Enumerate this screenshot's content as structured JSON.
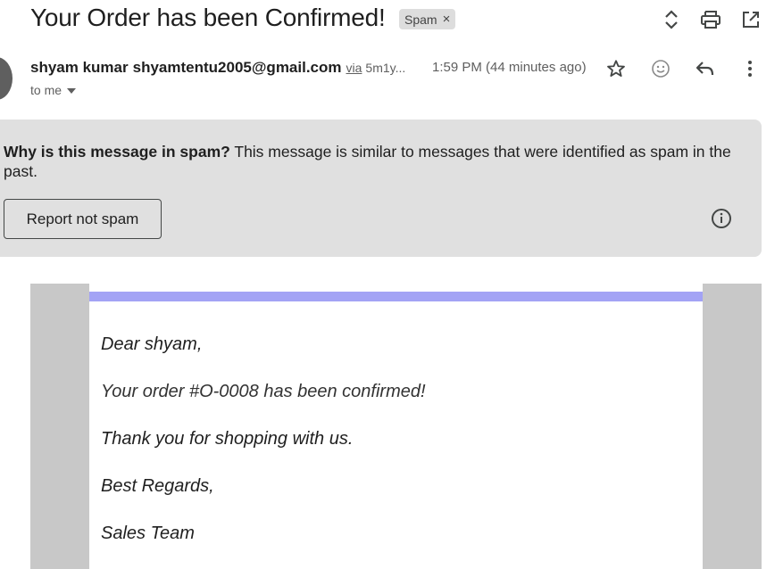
{
  "email": {
    "subject": "Your Order has been Confirmed!",
    "label_chip": "Spam",
    "label_remove": "×",
    "sender_name": "shyam kumar",
    "sender_email": "shyamtentu2005@gmail.com",
    "via_label": "via",
    "via_domain": "5m1y...",
    "time": "1:59 PM (44 minutes ago)",
    "recipient": "to me"
  },
  "spam_notice": {
    "heading": "Why is this message in spam?",
    "text": " This message is similar to messages that were identified as spam in the past.",
    "report_button": "Report not spam"
  },
  "body": {
    "greeting": "Dear shyam,",
    "order_line": "Your order #O-0008 has been confirmed!",
    "thanks_line": "Thank you for shopping with us.",
    "closing": "Best Regards,",
    "signature": "Sales Team"
  },
  "colors": {
    "accent_bar": "#a3a3f5",
    "banner_bg": "#e0e0e0",
    "frame_bg": "#c8c8c8"
  },
  "icons": {
    "expand": "unfold-icon",
    "print": "print-icon",
    "popout": "open-in-new-icon",
    "star": "star-icon",
    "emoji": "emoji-icon",
    "reply": "reply-icon",
    "more": "more-vert-icon",
    "info": "info-icon"
  }
}
